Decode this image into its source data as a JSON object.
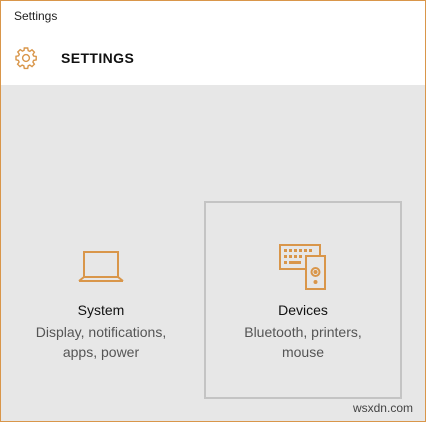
{
  "window": {
    "title": "Settings"
  },
  "header": {
    "title": "SETTINGS",
    "icon": "gear-icon"
  },
  "tiles": [
    {
      "name": "System",
      "desc_line1": "Display, notifications,",
      "desc_line2": "apps, power",
      "icon": "laptop-icon"
    },
    {
      "name": "Devices",
      "desc_line1": "Bluetooth, printers,",
      "desc_line2": "mouse",
      "icon": "devices-icon"
    }
  ],
  "colors": {
    "accent": "#d9964a",
    "background": "#e7e7e7",
    "tile_border": "#c4c4c4"
  },
  "watermark": "wsxdn.com"
}
